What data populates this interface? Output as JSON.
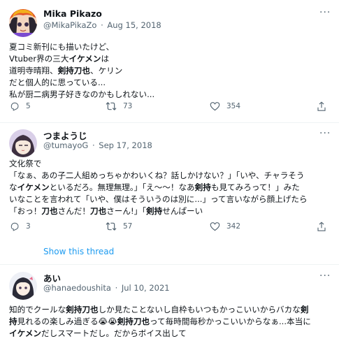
{
  "tweets": [
    {
      "name": "Mika Pikazo",
      "handle": "@MikaPikaZo",
      "sep": "·",
      "date": "Aug 15, 2018",
      "more": "···",
      "lines": [
        [
          {
            "t": "夏コミ新刊にも描いたけど、"
          }
        ],
        [
          {
            "t": "Vtuber界の三大"
          },
          {
            "t": "イケメン",
            "b": true
          },
          {
            "t": "は"
          }
        ],
        [
          {
            "t": "道明寺晴翔、"
          },
          {
            "t": "剣持刀也",
            "b": true
          },
          {
            "t": "、ケリン"
          }
        ],
        [
          {
            "t": "だと個人的に思っている..."
          }
        ],
        [
          {
            "t": "私が厨二病男子好きなのかもしれない..."
          }
        ]
      ],
      "replies": "5",
      "retweets": "73",
      "likes": "354"
    },
    {
      "name": "つまようじ",
      "handle": "@tumayoG",
      "sep": "·",
      "date": "Sep 17, 2018",
      "more": "···",
      "lines": [
        [
          {
            "t": "文化祭で"
          }
        ],
        [
          {
            "t": "「なぁ、あの子二人組めっちゃかわいくね？話しかけない？」「いや、チャラそう"
          }
        ],
        [
          {
            "t": "な"
          },
          {
            "t": "イケメン",
            "b": true
          },
          {
            "t": "といるだろ。無理無理。」「え〜～！なあ"
          },
          {
            "t": "剣持",
            "b": true
          },
          {
            "t": "も見てみろって！」みた"
          }
        ],
        [
          {
            "t": "いなことを言われて「いや、僕はそういうのは別に...」って言いながら顔上げたら"
          }
        ],
        [
          {
            "t": "「おっ！"
          },
          {
            "t": "刀也",
            "b": true
          },
          {
            "t": "さんだ！"
          },
          {
            "t": "刀也",
            "b": true
          },
          {
            "t": "さーん!」「"
          },
          {
            "t": "剣持",
            "b": true
          },
          {
            "t": "せんぱーい"
          }
        ]
      ],
      "replies": "3",
      "retweets": "57",
      "likes": "342",
      "show_thread": "Show this thread"
    },
    {
      "name": "あい",
      "handle": "@hanaedoushita",
      "sep": "·",
      "date": "Jul 10, 2021",
      "more": "···",
      "lines": [
        [
          {
            "t": "知的でクールな"
          },
          {
            "t": "剣持刀也",
            "b": true
          },
          {
            "t": "しか見たことないし自枠もいつもかっこいいからバカな"
          },
          {
            "t": "剣",
            "b": true
          }
        ],
        [
          {
            "t": "持",
            "b": true
          },
          {
            "t": "見れるの楽しみ過ぎる😭😭"
          },
          {
            "t": "剣持刀也",
            "b": true
          },
          {
            "t": "って毎時間毎秒かっこいいからなぁ...本当に"
          }
        ],
        [
          {
            "t": "イケメン",
            "b": true
          },
          {
            "t": "だしスマートだし。だからボイス出して"
          }
        ]
      ]
    }
  ],
  "colors": {
    "text": "#0f1419",
    "secondary": "#536471",
    "link": "#1d9bf0",
    "divider": "#eff3f4"
  },
  "icons": [
    "reply-icon",
    "retweet-icon",
    "like-icon",
    "share-icon"
  ]
}
